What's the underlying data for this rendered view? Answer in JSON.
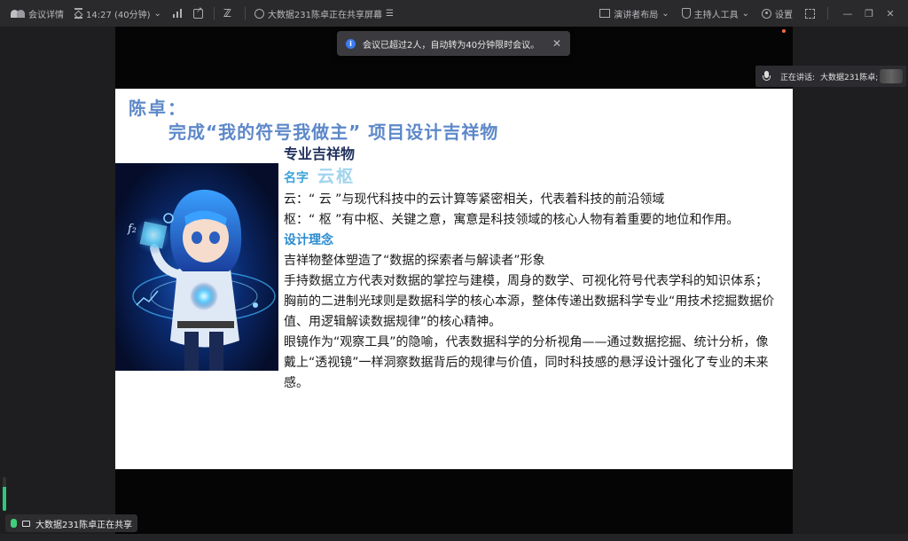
{
  "topbar": {
    "meeting_details": "会议详情",
    "time": "14:27 (40分钟)",
    "sharing_title": "大数据231陈卓正在共享屏幕",
    "presenter_layout": "演讲者布局",
    "host_tools": "主持人工具",
    "settings": "设置"
  },
  "toast": {
    "message": "会议已超过2人，自动转为40分钟限时会议。"
  },
  "speaker": {
    "label": "正在讲话:",
    "name": "大数据231陈卓;"
  },
  "slide": {
    "presenter": "陈卓：",
    "project_title": "完成“我的符号我做主” 项目设计吉祥物",
    "heading": "专业吉祥物",
    "name_label": "名字",
    "name_value": "云枢",
    "yun_line": "云：“ 云 ”与现代科技中的云计算等紧密相关，代表着科技的前沿领域",
    "shu_line": "枢：“ 枢 ”有中枢、关键之意，寓意是科技领域的核心人物有着重要的地位和作用。",
    "concept_heading": "设计理念",
    "para1": "吉祥物整体塑造了“数据的探索者与解读者”形象",
    "para2": "手持数据立方代表对数据的掌控与建模，周身的数学、可视化符号代表学科的知识体系；胸前的二进制光球则是数据科学的核心本源，整体传递出数据科学专业“用技术挖掘数据价值、用逻辑解读数据规律”的核心精神。",
    "para3": "眼镜作为“观察工具”的隐喻，代表数据科学的分析视角——通过数据挖掘、统计分析，像戴上“透视镜”一样洞察数据背后的规律与价值，同时科技感的悬浮设计强化了专业的未来感。",
    "f2_symbol": "f₂"
  },
  "share_badge": {
    "text": "大数据231陈卓正在共享"
  },
  "mic_level": 0.7,
  "icons": [
    "logo-icon",
    "hourglass-icon",
    "signal-icon",
    "share-out-icon",
    "annotate-icon",
    "screen-share-icon",
    "layout-icon",
    "shield-icon",
    "gear-icon",
    "fullscreen-icon",
    "info-icon",
    "close-icon",
    "mic-icon",
    "screen-icon"
  ]
}
